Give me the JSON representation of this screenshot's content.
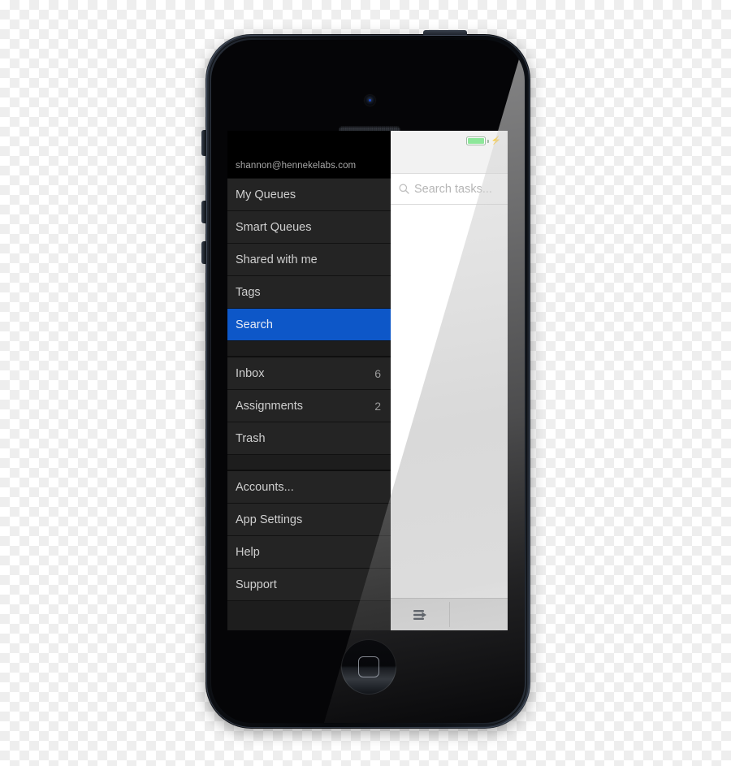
{
  "device": {
    "name": "iPhone 5 black",
    "camera_icon": "front-camera",
    "earpiece_icon": "earpiece-speaker",
    "home_button_icon": "home-button",
    "buttons": [
      {
        "name": "mute-switch"
      },
      {
        "name": "volume-up-button"
      },
      {
        "name": "volume-down-button"
      },
      {
        "name": "power-button"
      }
    ]
  },
  "app": {
    "sidebar": {
      "account_email": "shannon@hennekelabs.com",
      "groups": [
        {
          "items": [
            {
              "label": "My Queues",
              "badge": "",
              "selected": false
            },
            {
              "label": "Smart Queues",
              "badge": "",
              "selected": false
            },
            {
              "label": "Shared with me",
              "badge": "",
              "selected": false
            },
            {
              "label": "Tags",
              "badge": "",
              "selected": false
            },
            {
              "label": "Search",
              "badge": "",
              "selected": true
            }
          ]
        },
        {
          "items": [
            {
              "label": "Inbox",
              "badge": "6",
              "selected": false
            },
            {
              "label": "Assignments",
              "badge": "2",
              "selected": false
            },
            {
              "label": "Trash",
              "badge": "",
              "selected": false
            }
          ]
        },
        {
          "items": [
            {
              "label": "Accounts...",
              "badge": "",
              "selected": false
            },
            {
              "label": "App Settings",
              "badge": "",
              "selected": false
            },
            {
              "label": "Help",
              "badge": "",
              "selected": false
            },
            {
              "label": "Support",
              "badge": "",
              "selected": false
            }
          ]
        }
      ],
      "selected_accent": "#0d57c8"
    },
    "content": {
      "status_bar": {
        "battery_icon": "battery-charging-icon",
        "battery_color": "#8de79a",
        "charging_bolt_icon": "lightning-bolt-icon"
      },
      "search": {
        "icon": "search-icon",
        "placeholder": "Search tasks...",
        "value": ""
      },
      "toolbar": {
        "menu_icon": "list-arrow-icon"
      }
    }
  }
}
